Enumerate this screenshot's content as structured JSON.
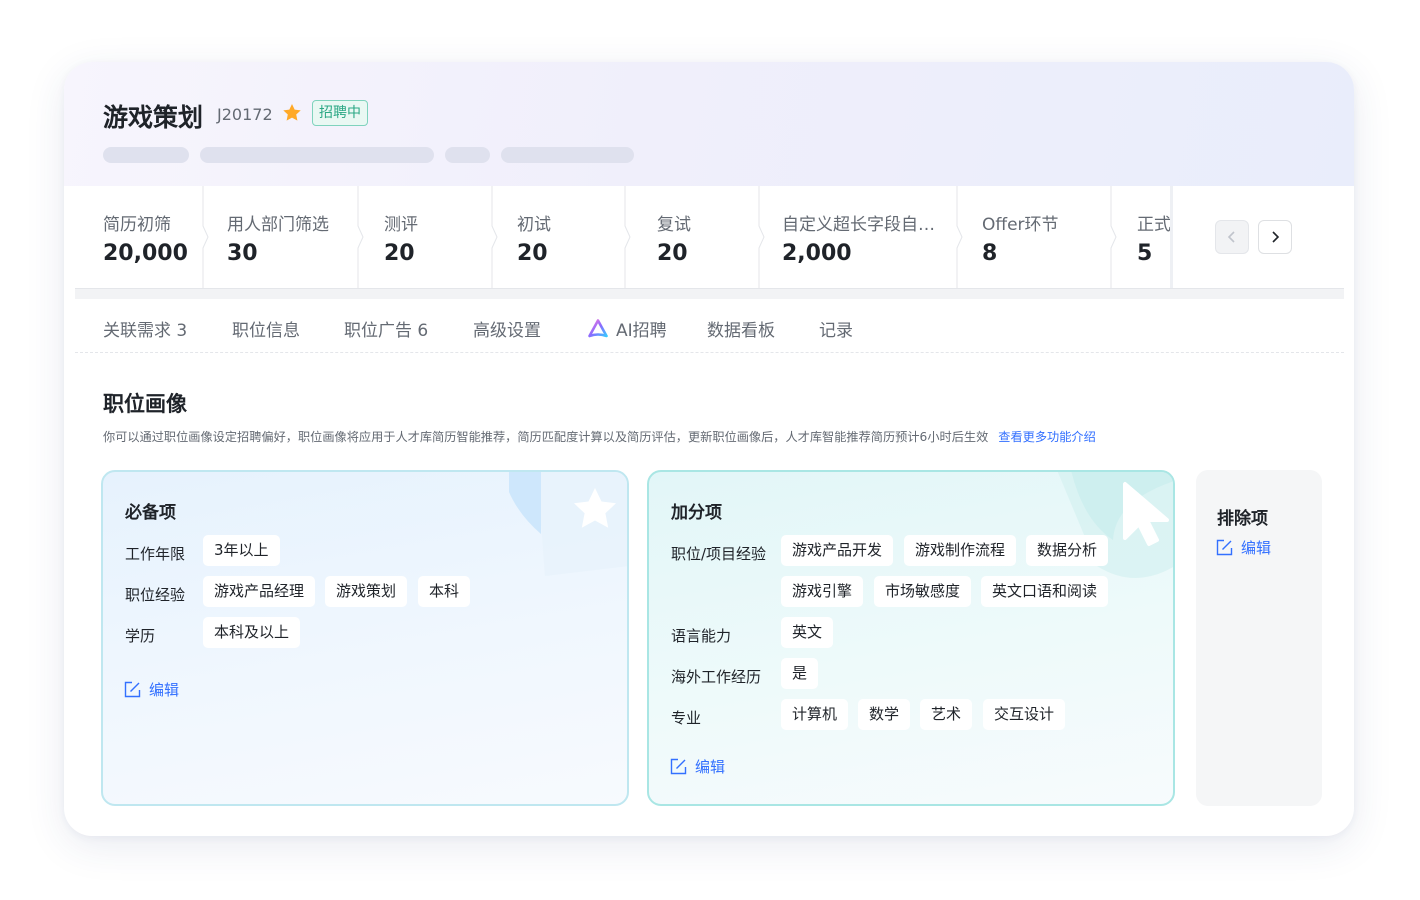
{
  "header": {
    "title": "游戏策划",
    "code": "J20172",
    "status": "招聘中",
    "colors": {
      "status_text": "#2aa784",
      "status_bg": "#e9f8f3",
      "star": "#ffa928"
    }
  },
  "stats": [
    {
      "label": "简历初筛",
      "value": "20,000"
    },
    {
      "label": "用人部门筛选",
      "value": "30"
    },
    {
      "label": "测评",
      "value": "20"
    },
    {
      "label": "初试",
      "value": "20"
    },
    {
      "label": "复试",
      "value": "20"
    },
    {
      "label": "自定义超长字段自…",
      "value": "2,000"
    },
    {
      "label": "Offer环节",
      "value": "8"
    },
    {
      "label": "正式",
      "value": "5"
    }
  ],
  "tabs": [
    {
      "label": "关联需求 3"
    },
    {
      "label": "职位信息"
    },
    {
      "label": "职位广告 6"
    },
    {
      "label": "高级设置"
    },
    {
      "label": "AI招聘",
      "icon": "ai-logo-icon"
    },
    {
      "label": "数据看板"
    },
    {
      "label": "记录"
    }
  ],
  "profile": {
    "title": "职位画像",
    "description": "你可以通过职位画像设定招聘偏好，职位画像将应用于人才库简历智能推荐，简历匹配度计算以及简历评估，更新职位画像后，人才库智能推荐简历预计6小时后生效",
    "more_link": "查看更多功能介绍"
  },
  "required": {
    "title": "必备项",
    "rows": [
      {
        "label": "工作年限",
        "tags": [
          "3年以上"
        ]
      },
      {
        "label": "职位经验",
        "tags": [
          "游戏产品经理",
          "游戏策划",
          "本科"
        ]
      },
      {
        "label": "学历",
        "tags": [
          "本科及以上"
        ]
      }
    ],
    "edit": "编辑"
  },
  "bonus": {
    "title": "加分项",
    "rows": [
      {
        "label": "职位/项目经验",
        "tags": [
          "游戏产品开发",
          "游戏制作流程",
          "数据分析",
          "游戏引擎",
          "市场敏感度",
          "英文口语和阅读"
        ]
      },
      {
        "label": "语言能力",
        "tags": [
          "英文"
        ]
      },
      {
        "label": "海外工作经历",
        "tags": [
          "是"
        ]
      },
      {
        "label": "专业",
        "tags": [
          "计算机",
          "数学",
          "艺术",
          "交互设计"
        ]
      }
    ],
    "edit": "编辑"
  },
  "exclude": {
    "title": "排除项",
    "edit": "编辑"
  }
}
